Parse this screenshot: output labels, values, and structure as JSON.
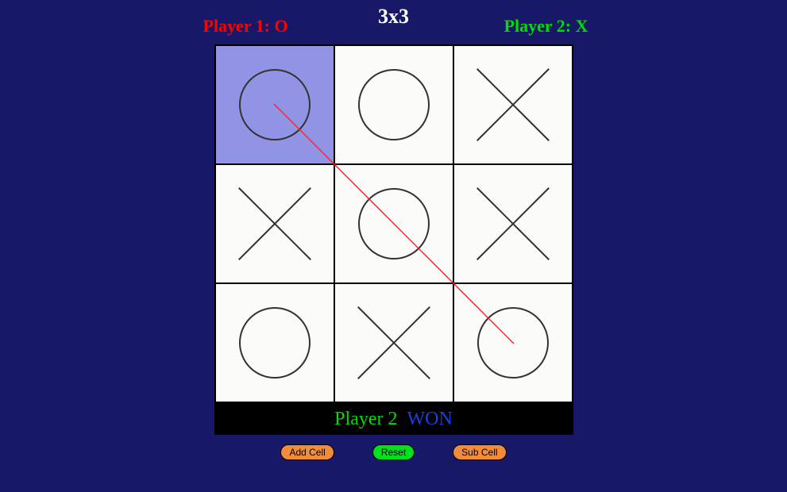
{
  "header": {
    "title": "3x3",
    "player1": "Player 1: O",
    "player2": "Player 2: X"
  },
  "board": {
    "size": 3,
    "cells": [
      {
        "mark": "O",
        "highlight": true
      },
      {
        "mark": "O",
        "highlight": false
      },
      {
        "mark": "X",
        "highlight": false
      },
      {
        "mark": "X",
        "highlight": false
      },
      {
        "mark": "O",
        "highlight": false
      },
      {
        "mark": "X",
        "highlight": false
      },
      {
        "mark": "O",
        "highlight": false
      },
      {
        "mark": "X",
        "highlight": false
      },
      {
        "mark": "O",
        "highlight": false
      }
    ],
    "win_line": {
      "type": "diagonal",
      "from": [
        0,
        0
      ],
      "to": [
        2,
        2
      ]
    }
  },
  "status": {
    "player": "Player 2",
    "result": "WON"
  },
  "buttons": {
    "add_cell": "Add Cell",
    "reset": "Reset",
    "sub_cell": "Sub Cell"
  }
}
